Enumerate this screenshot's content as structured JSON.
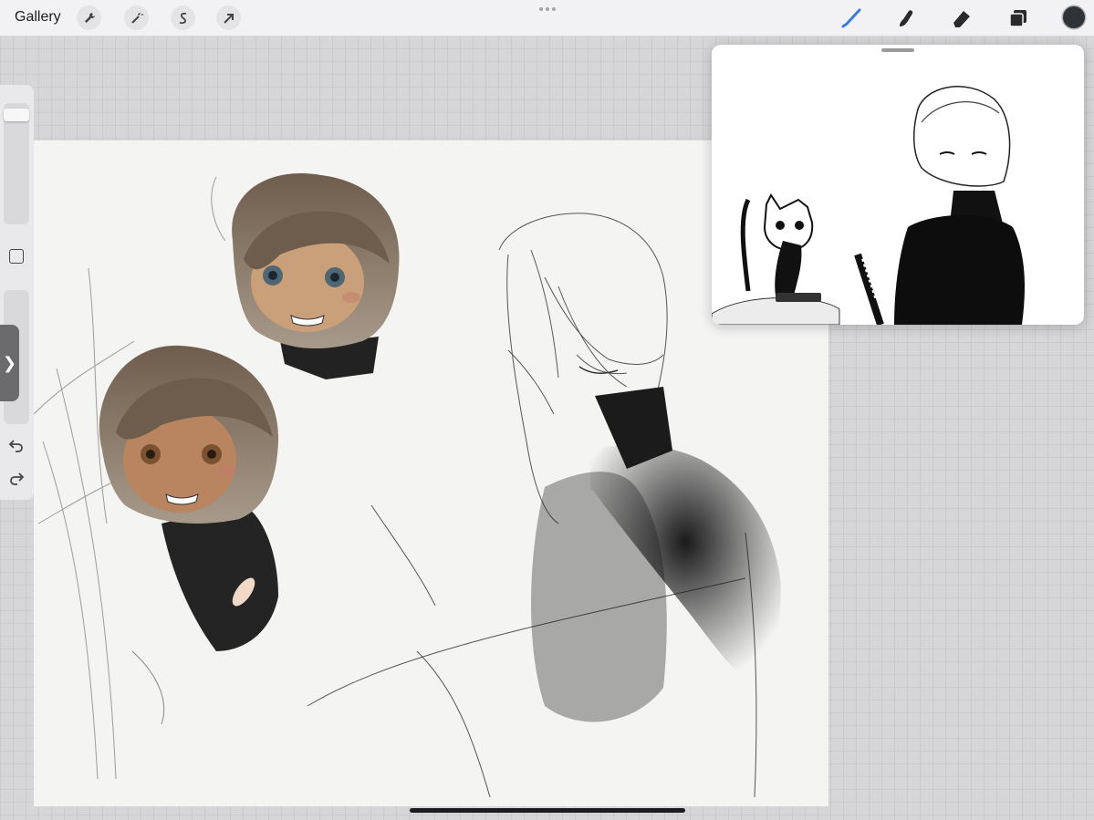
{
  "topbar": {
    "gallery_label": "Gallery",
    "left_tools": [
      "wrench-icon",
      "magic-wand-icon",
      "selection-s-icon",
      "arrow-transform-icon"
    ],
    "right_tools": [
      "brush-icon",
      "smudge-icon",
      "eraser-icon",
      "layers-icon"
    ],
    "active_color": "#2f3338",
    "brush_accent": "#3a7bd5"
  },
  "sidebar": {
    "brush_size_level": 0.05,
    "opacity_level": 0.05
  },
  "reference": {
    "title": ""
  }
}
